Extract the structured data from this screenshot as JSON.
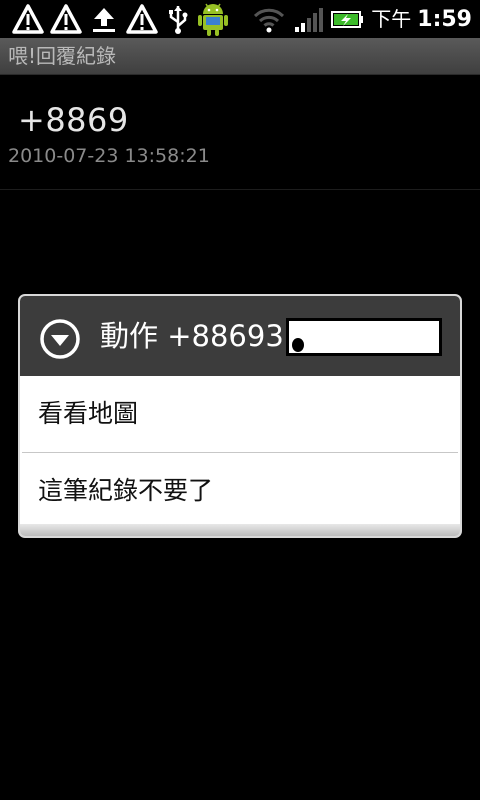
{
  "status_bar": {
    "icons": [
      "warning-icon",
      "warning-icon",
      "upload-icon",
      "warning-icon",
      "usb-icon",
      "android-icon",
      "wifi-icon",
      "signal-icon",
      "battery-charging-icon"
    ],
    "ampm": "下午",
    "time": "1:59"
  },
  "title_bar": {
    "title": "喂!回覆紀錄"
  },
  "record": {
    "number": "+8869",
    "datetime": "2010-07-23 13:58:21"
  },
  "dialog": {
    "title": "動作 +88693",
    "icon": "chevron-down-circle-icon",
    "items": [
      {
        "label": "看看地圖"
      },
      {
        "label": "這筆紀錄不要了"
      }
    ]
  },
  "colors": {
    "background": "#000000",
    "title_bar": "#4a4a4a",
    "dialog_header": "#3c3c3c",
    "dialog_body": "#ffffff"
  }
}
